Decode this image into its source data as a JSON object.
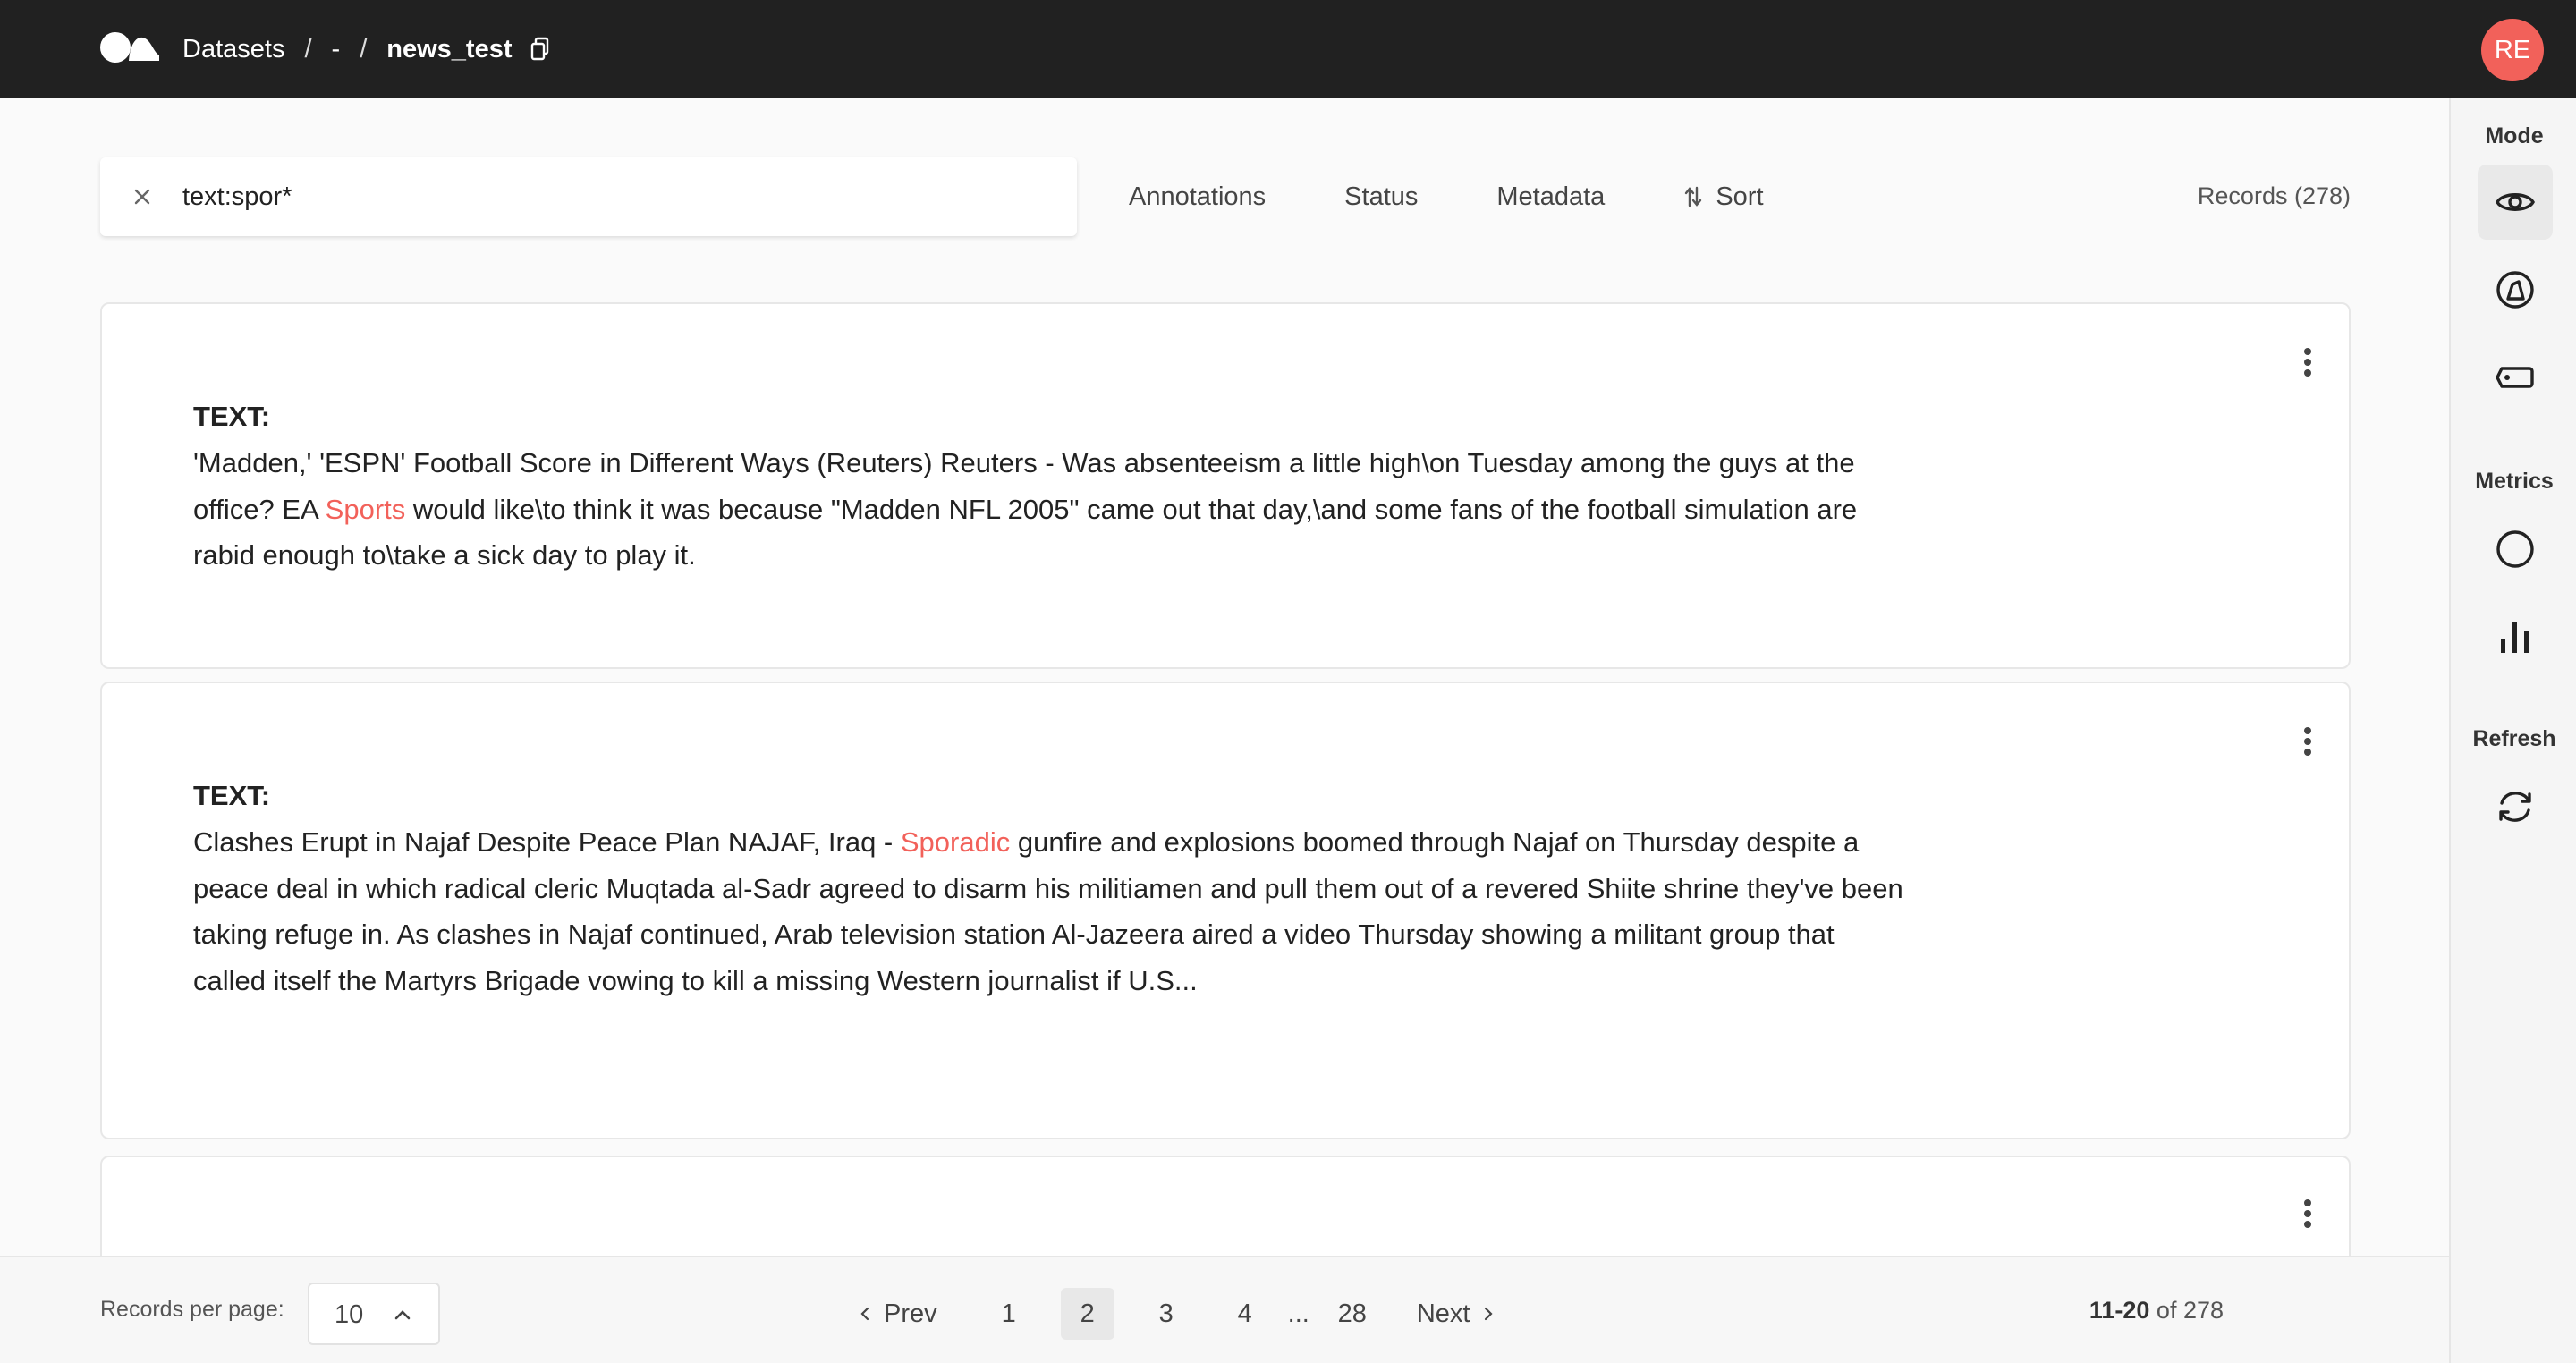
{
  "header": {
    "breadcrumbs": [
      "Datasets",
      "-",
      "news_test"
    ],
    "avatar_initials": "RE"
  },
  "search": {
    "query": "text:spor*"
  },
  "filters": {
    "annotations": "Annotations",
    "status": "Status",
    "metadata": "Metadata",
    "sort": "Sort",
    "records_label": "Records (278)"
  },
  "sidebar": {
    "mode_label": "Mode",
    "metrics_label": "Metrics",
    "refresh_label": "Refresh"
  },
  "records": [
    {
      "label": "TEXT:",
      "before": "'Madden,' 'ESPN' Football Score in Different Ways (Reuters) Reuters - Was absenteeism a little high\\on Tuesday among the guys at the office? EA ",
      "highlight": "Sports",
      "after": " would like\\to think it was because \"Madden NFL 2005\" came out that day,\\and some fans of the football simulation are rabid enough to\\take a sick day to play it."
    },
    {
      "label": "TEXT:",
      "before": "Clashes Erupt in Najaf Despite Peace Plan NAJAF, Iraq - ",
      "highlight": "Sporadic",
      "after": " gunfire and explosions boomed through Najaf on Thursday despite a peace deal in which radical cleric Muqtada al-Sadr agreed to disarm his militiamen and pull them out of a revered Shiite shrine they've been taking refuge in. As clashes in Najaf continued, Arab television station Al-Jazeera aired a video Thursday showing a militant group that called itself the Martyrs Brigade vowing to kill a missing Western journalist if U.S..."
    }
  ],
  "pagination": {
    "per_page_label": "Records per page:",
    "per_page_value": "10",
    "prev": "Prev",
    "next": "Next",
    "pages": [
      "1",
      "2",
      "3",
      "4",
      "...",
      "28"
    ],
    "current": "2",
    "range": "11-20",
    "of_total": "of 278"
  },
  "colors": {
    "accent": "#f2615a",
    "topbar": "#212121"
  }
}
